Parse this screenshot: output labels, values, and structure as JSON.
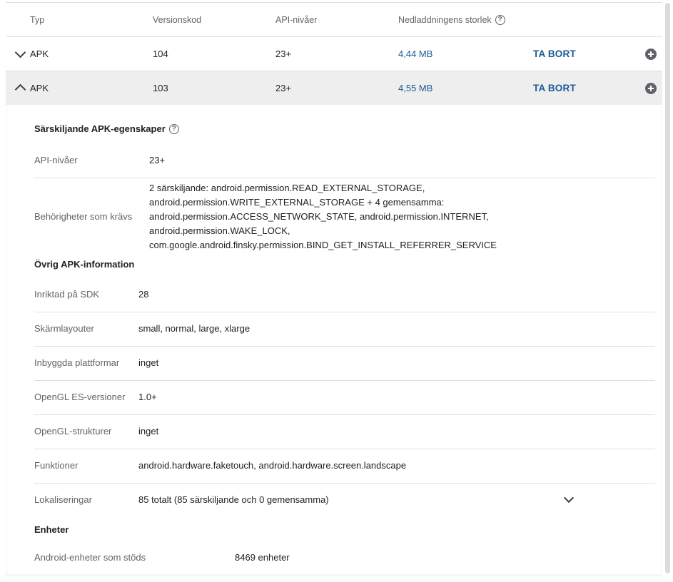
{
  "table": {
    "headers": {
      "type": "Typ",
      "version_code": "Versionskod",
      "api_levels": "API-nivåer",
      "download_size": "Nedladdningens storlek"
    },
    "rows": [
      {
        "type": "APK",
        "version_code": "104",
        "api_levels": "23+",
        "size": "4,44 MB",
        "delete": "TA BORT",
        "state": "collapsed"
      },
      {
        "type": "APK",
        "version_code": "103",
        "api_levels": "23+",
        "size": "4,55 MB",
        "delete": "TA BORT",
        "state": "expanded"
      }
    ]
  },
  "details": {
    "distinct_title": "Särskiljande APK-egenskaper",
    "distinct": {
      "api_label": "API-nivåer",
      "api_value": "23+",
      "perm_label": "Behörigheter som krävs",
      "perm_lines": [
        "2 särskiljande: android.permission.READ_EXTERNAL_STORAGE,",
        "android.permission.WRITE_EXTERNAL_STORAGE + 4 gemensamma:",
        "android.permission.ACCESS_NETWORK_STATE, android.permission.INTERNET,",
        "android.permission.WAKE_LOCK,",
        "com.google.android.finsky.permission.BIND_GET_INSTALL_REFERRER_SERVICE"
      ]
    },
    "other_title": "Övrig APK-information",
    "other": [
      {
        "label": "Inriktad på SDK",
        "value": "28"
      },
      {
        "label": "Skärmlayouter",
        "value": "small, normal, large, xlarge"
      },
      {
        "label": "Inbyggda plattformar",
        "value": "inget"
      },
      {
        "label": "OpenGL ES-versioner",
        "value": "1.0+"
      },
      {
        "label": "OpenGL-strukturer",
        "value": "inget"
      },
      {
        "label": "Funktioner",
        "value": "android.hardware.faketouch, android.hardware.screen.landscape"
      },
      {
        "label": "Lokaliseringar",
        "value": "85 totalt (85 särskiljande och 0 gemensamma)"
      }
    ],
    "devices_title": "Enheter",
    "devices_label": "Android-enheter som stöds",
    "devices_value": "8469 enheter"
  }
}
